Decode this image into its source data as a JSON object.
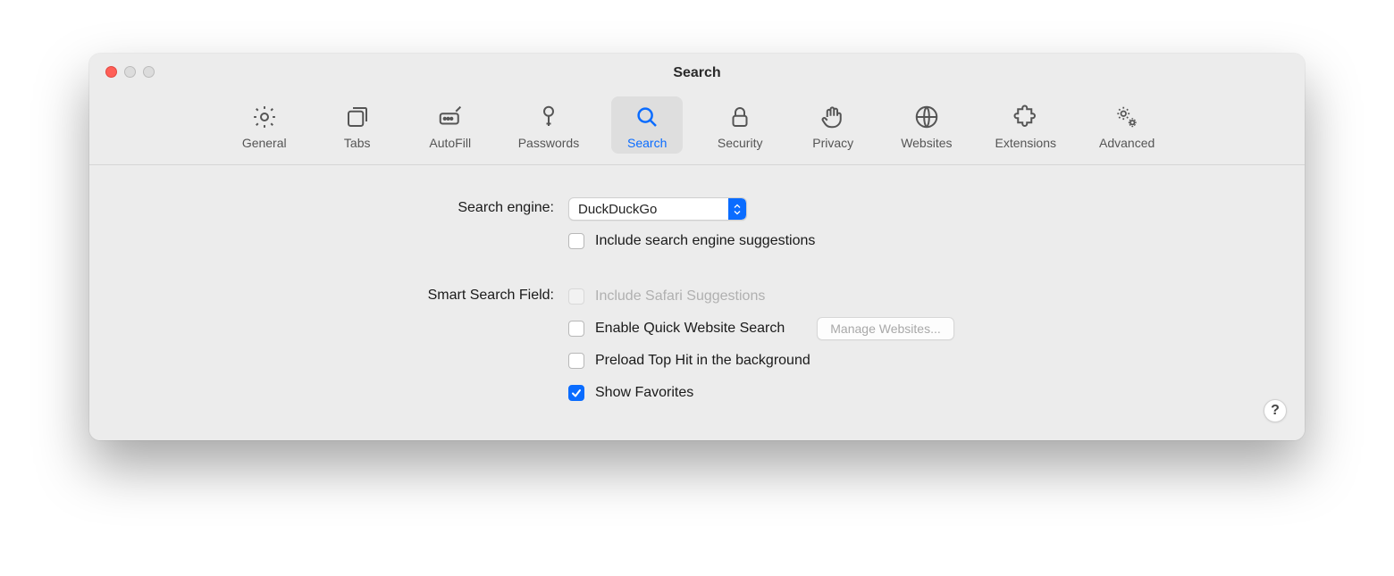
{
  "window": {
    "title": "Search"
  },
  "toolbar": {
    "items": [
      {
        "id": "general",
        "label": "General",
        "icon": "gear-icon",
        "selected": false
      },
      {
        "id": "tabs",
        "label": "Tabs",
        "icon": "tabs-icon",
        "selected": false
      },
      {
        "id": "autofill",
        "label": "AutoFill",
        "icon": "autofill-icon",
        "selected": false
      },
      {
        "id": "passwords",
        "label": "Passwords",
        "icon": "key-icon",
        "selected": false
      },
      {
        "id": "search",
        "label": "Search",
        "icon": "search-icon",
        "selected": true
      },
      {
        "id": "security",
        "label": "Security",
        "icon": "lock-icon",
        "selected": false
      },
      {
        "id": "privacy",
        "label": "Privacy",
        "icon": "hand-icon",
        "selected": false
      },
      {
        "id": "websites",
        "label": "Websites",
        "icon": "globe-icon",
        "selected": false
      },
      {
        "id": "extensions",
        "label": "Extensions",
        "icon": "puzzle-icon",
        "selected": false
      },
      {
        "id": "advanced",
        "label": "Advanced",
        "icon": "gears-icon",
        "selected": false
      }
    ]
  },
  "sections": {
    "search_engine": {
      "label": "Search engine:",
      "popup_value": "DuckDuckGo",
      "include_suggestions": {
        "label": "Include search engine suggestions",
        "checked": false
      }
    },
    "smart_search": {
      "label": "Smart Search Field:",
      "safari_suggestions": {
        "label": "Include Safari Suggestions",
        "checked": false,
        "disabled": true
      },
      "quick_website_search": {
        "label": "Enable Quick Website Search",
        "checked": false,
        "button_label": "Manage Websites..."
      },
      "preload_top_hit": {
        "label": "Preload Top Hit in the background",
        "checked": false
      },
      "show_favorites": {
        "label": "Show Favorites",
        "checked": true
      }
    }
  },
  "help_button": "?"
}
